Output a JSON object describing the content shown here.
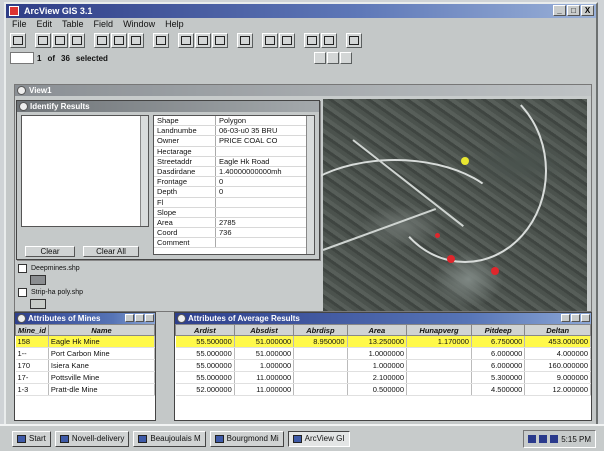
{
  "app": {
    "title": "ArcView GIS 3.1"
  },
  "window_controls": [
    "_",
    "□",
    "X"
  ],
  "menu": [
    "File",
    "Edit",
    "Table",
    "Field",
    "Window",
    "Help"
  ],
  "selection": {
    "count": "1",
    "of_label": "of",
    "total": "36",
    "selected_label": "selected"
  },
  "view": {
    "title": "View1"
  },
  "identify": {
    "title": "Identify Results",
    "attributes": [
      {
        "k": "Shape",
        "v": "Polygon"
      },
      {
        "k": "Landnumbe",
        "v": "06-03-u0 35 BRU"
      },
      {
        "k": "Owner",
        "v": "PRICE COAL CO"
      },
      {
        "k": "Hectarage",
        "v": ""
      },
      {
        "k": "Streetaddr",
        "v": "Eagle Hk Road"
      },
      {
        "k": "Dasdirdane",
        "v": "1.40000000000mh"
      },
      {
        "k": "Frontage",
        "v": "0"
      },
      {
        "k": "Depth",
        "v": "0"
      },
      {
        "k": "Fl",
        "v": ""
      },
      {
        "k": "Slope",
        "v": ""
      },
      {
        "k": "Area",
        "v": "2785"
      },
      {
        "k": "Coord",
        "v": "736"
      },
      {
        "k": "Comment",
        "v": ""
      }
    ],
    "clear_label": "Clear",
    "clear_all_label": "Clear All"
  },
  "legend": {
    "items": [
      {
        "label": "Deepmines.shp",
        "color": "#8a8d90"
      },
      {
        "label": "Strip-ha poly.shp",
        "color": "#c8ccc8"
      }
    ]
  },
  "attributes_table": {
    "title": "Attributes of Mines",
    "headers": [
      "Mine_id",
      "Name"
    ],
    "rows": [
      {
        "id": "158",
        "name": "Eagle Hk Mine",
        "hl": true
      },
      {
        "id": "1--",
        "name": "Port Carbon Mine",
        "hl": false
      },
      {
        "id": "170",
        "name": "Isiera Kane",
        "hl": false
      },
      {
        "id": "17-",
        "name": "Pottsville Mine",
        "hl": false
      },
      {
        "id": "1-3",
        "name": "Pratt-dle Mine",
        "hl": false
      }
    ]
  },
  "results_table": {
    "title": "Attributes of Average Results",
    "headers": [
      "Ardist",
      "Absdist",
      "Abrdisp",
      "Area",
      "Hunapverg",
      "Pitdeep",
      "Deltan"
    ],
    "rows": [
      {
        "c": [
          "55.500000",
          "51.000000",
          "8.950000",
          "13.250000",
          "1.170000",
          "6.750000",
          "453.000000"
        ],
        "hl": true
      },
      {
        "c": [
          "55.000000",
          "51.000000",
          "",
          "1.0000000",
          "",
          "6.000000",
          "4.000000"
        ],
        "hl": false
      },
      {
        "c": [
          "55.000000",
          "1.000000",
          "",
          "1.000000",
          "",
          "6.000000",
          "160.000000"
        ],
        "hl": false
      },
      {
        "c": [
          "55.000000",
          "11.000000",
          "",
          "2.100000",
          "",
          "5.300000",
          "9.000000"
        ],
        "hl": false
      },
      {
        "c": [
          "52.000000",
          "11.000000",
          "",
          "0.500000",
          "",
          "4.500000",
          "12.000000"
        ],
        "hl": false
      }
    ]
  },
  "taskbar": {
    "start_label": "Start",
    "tasks": [
      {
        "label": "Novell-delivery",
        "active": false
      },
      {
        "label": "Beaujoulais M",
        "active": false
      },
      {
        "label": "Bourgmond Mi",
        "active": false
      },
      {
        "label": "ArcView GI",
        "active": true
      }
    ],
    "clock": "5:15 PM"
  },
  "colors": {
    "highlight": "#fff94a",
    "titlebar": "#2f3d86",
    "map_point_red": "#e0262c",
    "map_point_yellow": "#e8e630"
  }
}
